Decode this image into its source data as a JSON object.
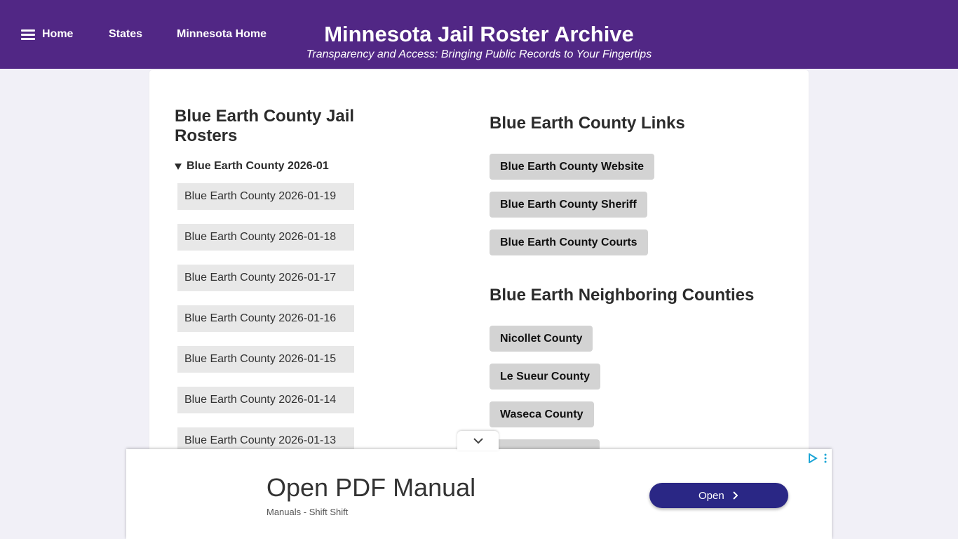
{
  "nav": {
    "home_label": "Home",
    "states_label": "States",
    "minnesota_home_label": "Minnesota Home"
  },
  "header": {
    "title": "Minnesota Jail Roster Archive",
    "tagline": "Transparency and Access: Bringing Public Records to Your Fingertips"
  },
  "rosters": {
    "heading_line1": "Blue Earth County Jail",
    "heading_line2": "Rosters",
    "month_label": "Blue Earth County 2026-01",
    "items": [
      "Blue Earth County 2026-01-19",
      "Blue Earth County 2026-01-18",
      "Blue Earth County 2026-01-17",
      "Blue Earth County 2026-01-16",
      "Blue Earth County 2026-01-15",
      "Blue Earth County 2026-01-14",
      "Blue Earth County 2026-01-13"
    ]
  },
  "links": {
    "heading": "Blue Earth County Links",
    "items": [
      "Blue Earth County Website",
      "Blue Earth County Sheriff",
      "Blue Earth County Courts"
    ]
  },
  "neighbors": {
    "heading": "Blue Earth Neighboring Counties",
    "items": [
      "Nicollet County",
      "Le Sueur County",
      "Waseca County"
    ]
  },
  "ad": {
    "title": "Open PDF Manual",
    "source": "Manuals - Shift Shift",
    "button_label": "Open"
  },
  "icons": {
    "menu": "hamburger-icon",
    "ad_collapse": "chevron-down-icon",
    "ad_button": "chevron-right-icon",
    "ad_choices": "adchoices-icon",
    "ad_menu": "kebab-menu-icon"
  },
  "colors": {
    "header_bg": "#512785",
    "page_bg": "#f1f0f7",
    "ad_button_bg": "#2a2785",
    "link_button_bg": "#d3d3d3",
    "roster_item_bg": "#e8e8e8"
  }
}
